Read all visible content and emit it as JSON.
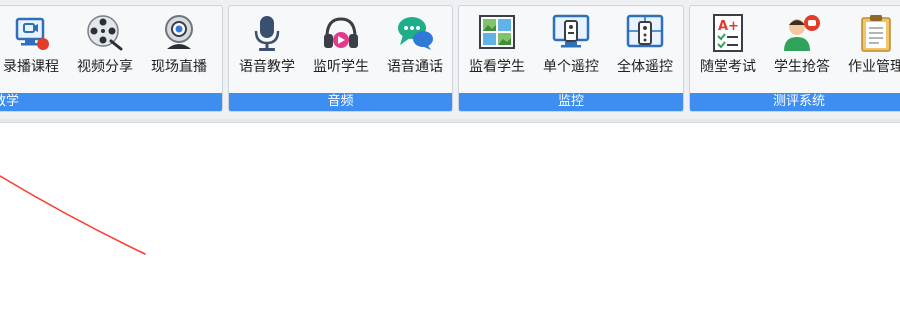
{
  "colors": {
    "group_label_bg": "#3d8ef0",
    "ribbon_bg": "#eef0f3",
    "stroke_red": "#ff3b2f"
  },
  "groups": [
    {
      "label": "教学",
      "buttons": [
        {
          "label": "录播课程",
          "icon": "record-course-icon"
        },
        {
          "label": "视频分享",
          "icon": "film-reel-icon"
        },
        {
          "label": "现场直播",
          "icon": "webcam-icon"
        }
      ]
    },
    {
      "label": "音频",
      "buttons": [
        {
          "label": "语音教学",
          "icon": "microphone-icon"
        },
        {
          "label": "监听学生",
          "icon": "headphones-icon"
        },
        {
          "label": "语音通话",
          "icon": "chat-bubble-icon"
        }
      ]
    },
    {
      "label": "监控",
      "buttons": [
        {
          "label": "监看学生",
          "icon": "monitor-grid-icon"
        },
        {
          "label": "单个遥控",
          "icon": "remote-single-icon"
        },
        {
          "label": "全体遥控",
          "icon": "remote-all-icon"
        }
      ]
    },
    {
      "label": "测评系统",
      "buttons": [
        {
          "label": "随堂考试",
          "icon": "exam-grade-icon"
        },
        {
          "label": "学生抢答",
          "icon": "student-quiz-icon"
        },
        {
          "label": "作业管理",
          "icon": "clipboard-icon"
        }
      ]
    }
  ]
}
